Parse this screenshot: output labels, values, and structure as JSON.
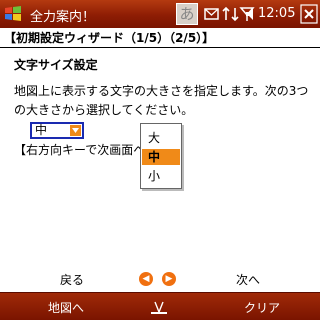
{
  "titlebar": {
    "title": "全力案内！",
    "ime_label": "あ",
    "time": "12:05"
  },
  "wizard": {
    "header": "【初期設定ウィザード（1/5）（2/5）】",
    "section_title": "文字サイズ設定",
    "description": "地図上に表示する文字の大きさを指定します。次の3つの大きさから選択してください。",
    "hint": "【右方向キーで次画面へ】"
  },
  "size_select": {
    "value": "中",
    "options": [
      "大",
      "中",
      "小"
    ],
    "selected_index": 1
  },
  "nav": {
    "back_label": "戻る",
    "next_label": "次へ"
  },
  "softkeys": {
    "left": "地図へ",
    "right": "クリア"
  },
  "colors": {
    "titlebar": "#8e1d04",
    "accent": "#f08a18",
    "combo_border": "#1a2ab0"
  }
}
